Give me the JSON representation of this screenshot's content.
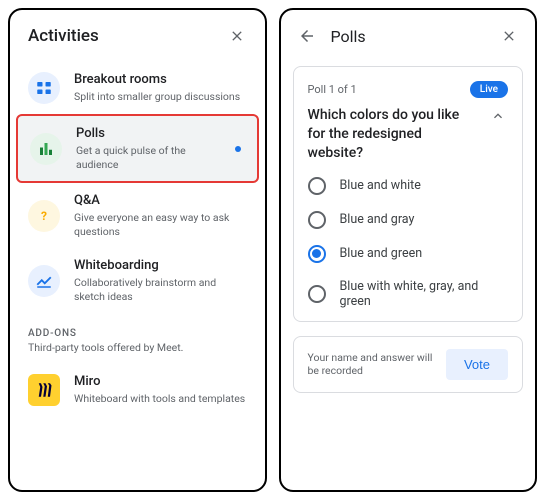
{
  "left": {
    "title": "Activities",
    "items": [
      {
        "name": "Breakout rooms",
        "desc": "Split into smaller group discussions"
      },
      {
        "name": "Polls",
        "desc": "Get a quick pulse of the audience"
      },
      {
        "name": "Q&A",
        "desc": "Give everyone an easy way to ask questions"
      },
      {
        "name": "Whiteboarding",
        "desc": "Collaboratively brainstorm and sketch ideas"
      }
    ],
    "addons_label": "ADD-ONS",
    "addons_desc": "Third-party tools offered by Meet.",
    "addons": [
      {
        "name": "Miro",
        "desc": "Whiteboard with tools and templates"
      }
    ]
  },
  "right": {
    "title": "Polls",
    "poll_count": "Poll 1 of 1",
    "live": "Live",
    "question": "Which colors do you like for the redesigned website?",
    "options": [
      "Blue and white",
      "Blue and gray",
      "Blue and green",
      "Blue with white, gray, and green"
    ],
    "selected_index": 2,
    "footer_note": "Your name and answer will be recorded",
    "vote": "Vote"
  }
}
